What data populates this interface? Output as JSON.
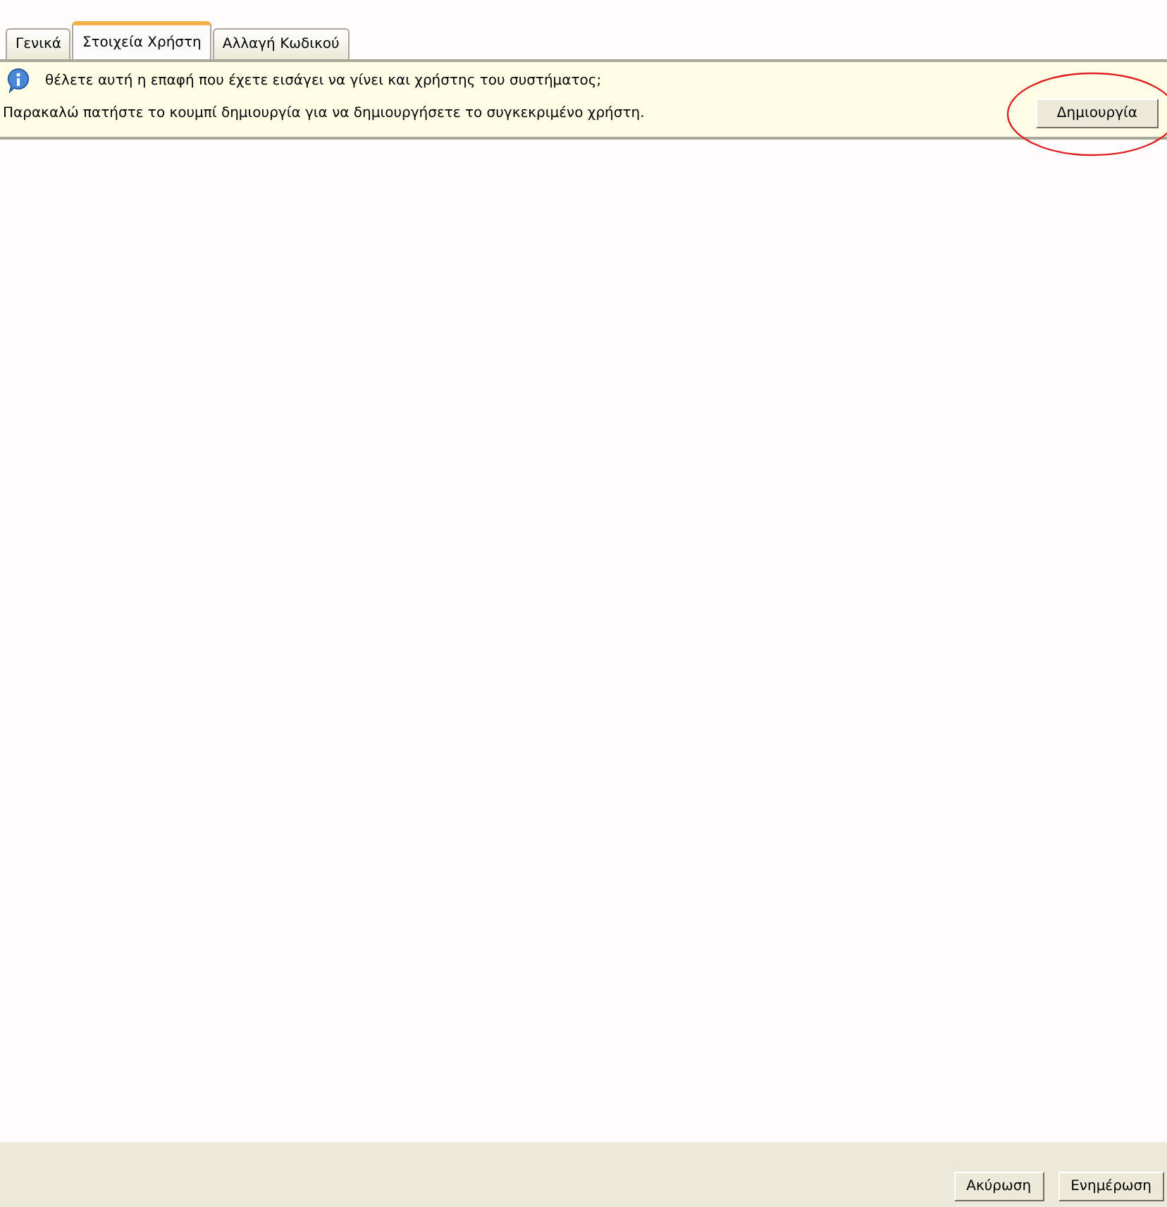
{
  "tabs": [
    {
      "label": "Γενικά",
      "selected": false
    },
    {
      "label": "Στοιχεία Χρήστη",
      "selected": true
    },
    {
      "label": "Αλλαγή Κωδικού",
      "selected": false
    }
  ],
  "notice": {
    "question": "θέλετε αυτή η επαφή που έχετε εισάγει να γίνει και χρήστης του συστήματος;",
    "instruction": "Παρακαλώ πατήστε το κουμπί δημιουργία για να δημιουργήσετε το συγκεκριμένο χρήστη.",
    "button": "Δημιουργία",
    "highlighted": true
  },
  "footer_buttons": [
    "Ακύρωση",
    "Ενημέρωση"
  ]
}
